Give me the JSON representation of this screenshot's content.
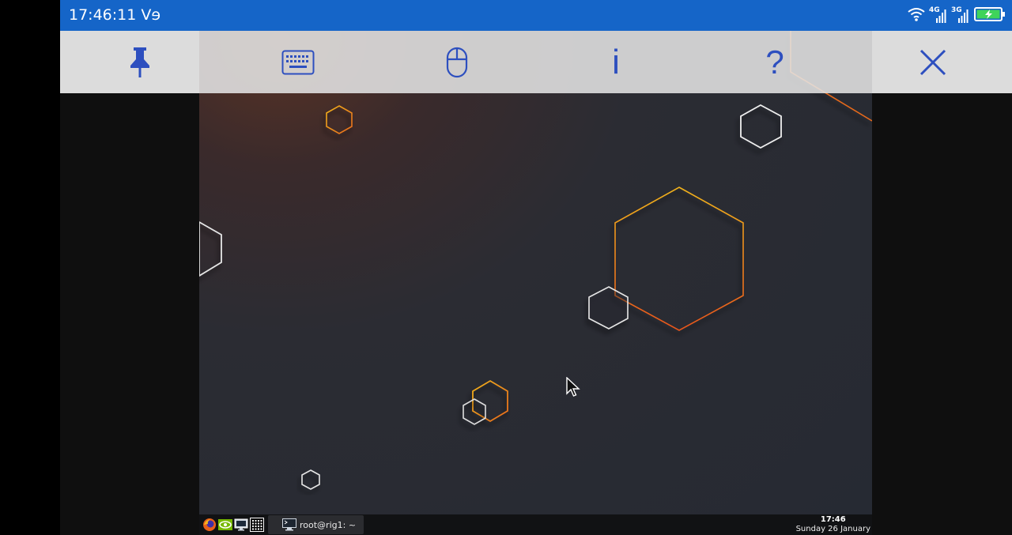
{
  "status_bar": {
    "time": "17:46:11 Vɘ",
    "wifi_icon": "wifi-icon",
    "signal1_label": "4G",
    "signal2_label": "3G",
    "battery_icon": "battery-charging-icon"
  },
  "toolbar": {
    "pin_icon": "pin-icon",
    "keyboard_icon": "keyboard-icon",
    "mouse_icon": "mouse-icon",
    "info_label": "i",
    "help_label": "?",
    "close_icon": "close-icon",
    "accent_color": "#2d4fbf"
  },
  "remote_desktop": {
    "taskbar": {
      "launchers": [
        "firefox-icon",
        "nvidia-icon",
        "monitor-icon",
        "app-grid-icon"
      ],
      "task_item_label": "root@rig1: ~",
      "clock_time": "17:46",
      "clock_date": "Sunday 26 January"
    },
    "wallpaper_colors": {
      "base": "#262a33",
      "glow": "#5a3325",
      "orange": "#e86a1a",
      "yellow": "#f0b21a",
      "white": "#e6e6e6"
    }
  }
}
